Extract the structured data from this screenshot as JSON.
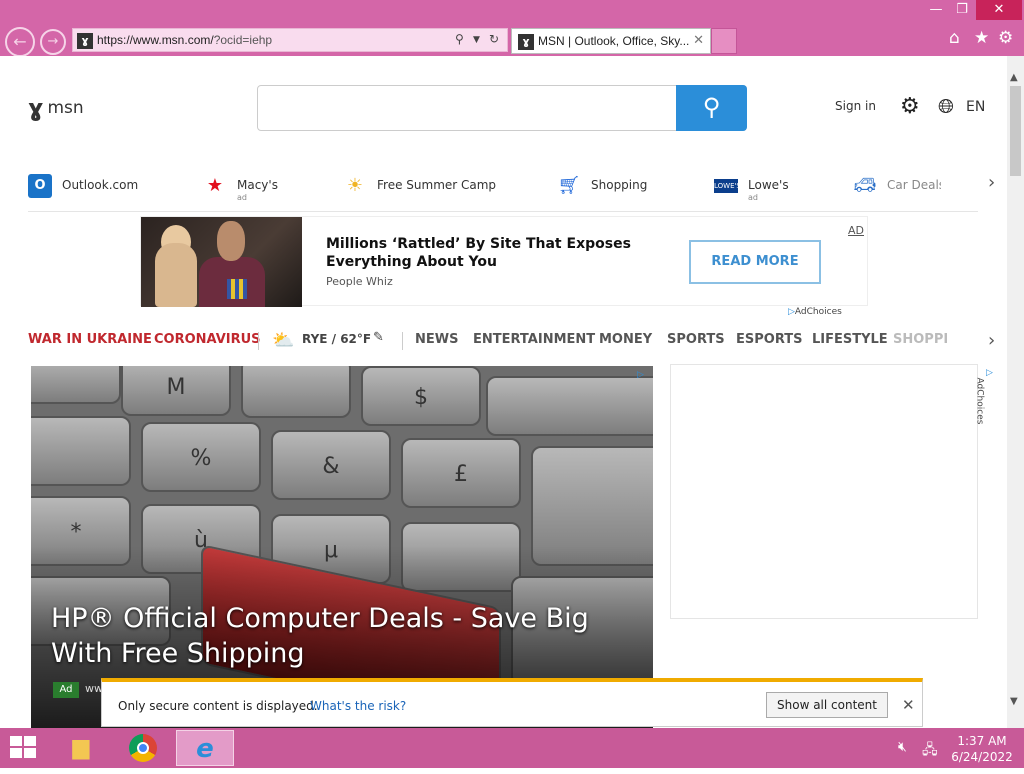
{
  "window": {
    "controls": [
      "—",
      "❐",
      "✕"
    ]
  },
  "browser": {
    "address_host": "https://www.msn.com/",
    "address_query": "?ocid=iehp",
    "tab_title": "MSN | Outlook, Office, Sky...",
    "tab_close": "✕"
  },
  "header": {
    "logo_text": "msn",
    "search_value": "",
    "sign_in": "Sign in",
    "language": "EN"
  },
  "quicklinks": [
    {
      "label": "Outlook.com",
      "ad": "",
      "icon": "outlook-icon"
    },
    {
      "label": "Macy's",
      "ad": "ad",
      "icon": "macys-star-icon"
    },
    {
      "label": "Free Summer Camp",
      "ad": "",
      "icon": "sun-icon"
    },
    {
      "label": "Shopping",
      "ad": "",
      "icon": "cart-icon"
    },
    {
      "label": "Lowe's",
      "ad": "ad",
      "icon": "lowes-icon"
    },
    {
      "label": "Car Deals",
      "ad": "",
      "icon": "car-icon"
    }
  ],
  "ad_banner": {
    "headline": "Millions ‘Rattled’ By Site That Exposes Everything About You",
    "source": "People Whiz",
    "cta": "READ MORE",
    "tag": "AD",
    "adchoices": "AdChoices"
  },
  "nav": {
    "items_red": [
      "WAR IN UKRAINE",
      "CORONAVIRUS"
    ],
    "weather": "RYE / 62°F",
    "items": [
      "NEWS",
      "ENTERTAINMENT",
      "MONEY",
      "SPORTS",
      "ESPORTS",
      "LIFESTYLE",
      "SHOPPI"
    ]
  },
  "hero": {
    "title": "HP® Official Computer Deals - Save Big With Free Shipping",
    "ad_badge": "Ad",
    "source": "ww"
  },
  "side_ad": {
    "adchoices": "AdChoices"
  },
  "infobar": {
    "message": "Only secure content is displayed.",
    "link": "What's the risk?",
    "button": "Show all content",
    "close": "✕"
  },
  "taskbar": {
    "time": "1:37 AM",
    "date": "6/24/2022"
  },
  "colors": {
    "chrome": "#d466a8",
    "taskbar": "#c85a98",
    "accent": "#2b8ed9",
    "nav_red": "#c0282e"
  }
}
